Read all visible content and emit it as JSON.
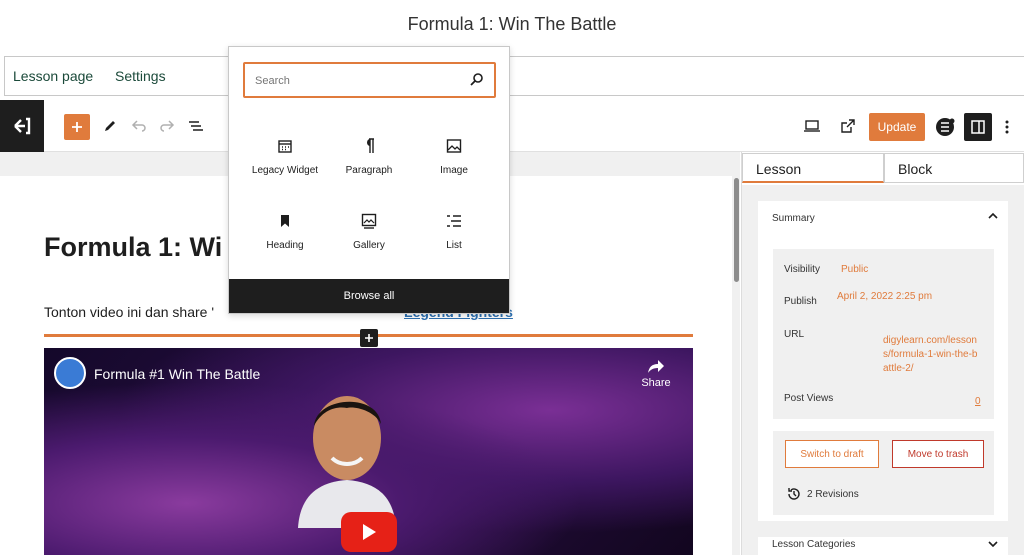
{
  "page_title": "Formula 1: Win The Battle",
  "tabs": [
    {
      "label": "Lesson page"
    },
    {
      "label": "Settings"
    }
  ],
  "toolbar": {
    "update_label": "Update",
    "logo_icon": "wp-back-icon",
    "add_icon": "plus-icon"
  },
  "inserter": {
    "search_placeholder": "Search",
    "blocks": [
      {
        "label": "Legacy Widget",
        "icon": "calendar-icon"
      },
      {
        "label": "Paragraph",
        "icon": "paragraph-icon"
      },
      {
        "label": "Image",
        "icon": "image-icon"
      },
      {
        "label": "Heading",
        "icon": "bookmark-icon"
      },
      {
        "label": "Gallery",
        "icon": "gallery-icon"
      },
      {
        "label": "List",
        "icon": "list-icon"
      }
    ],
    "browse_all": "Browse all"
  },
  "editor": {
    "title": "Formula 1: Wi",
    "text_prefix": "Tonton video ini dan share '",
    "text_link": "Legend Fighters"
  },
  "video": {
    "title": "Formula #1 Win The Battle",
    "share_label": "Share"
  },
  "sidebar": {
    "tabs": [
      "Lesson",
      "Block"
    ],
    "summary": {
      "heading": "Summary",
      "visibility_label": "Visibility",
      "visibility_value": "Public",
      "publish_label": "Publish",
      "publish_value": "April 2, 2022 2:25 pm",
      "url_label": "URL",
      "url_value": "digylearn.com/lessons/formula-1-win-the-battle-2/",
      "post_views_label": "Post Views",
      "post_views_value": "0",
      "switch_draft": "Switch to draft",
      "move_trash": "Move to trash",
      "revisions": "2 Revisions"
    },
    "categories_heading": "Lesson Categories"
  },
  "colors": {
    "accent": "#e07b3c",
    "dark": "#1e1e1e",
    "link": "#2c6fb0",
    "danger": "#c0392b"
  }
}
